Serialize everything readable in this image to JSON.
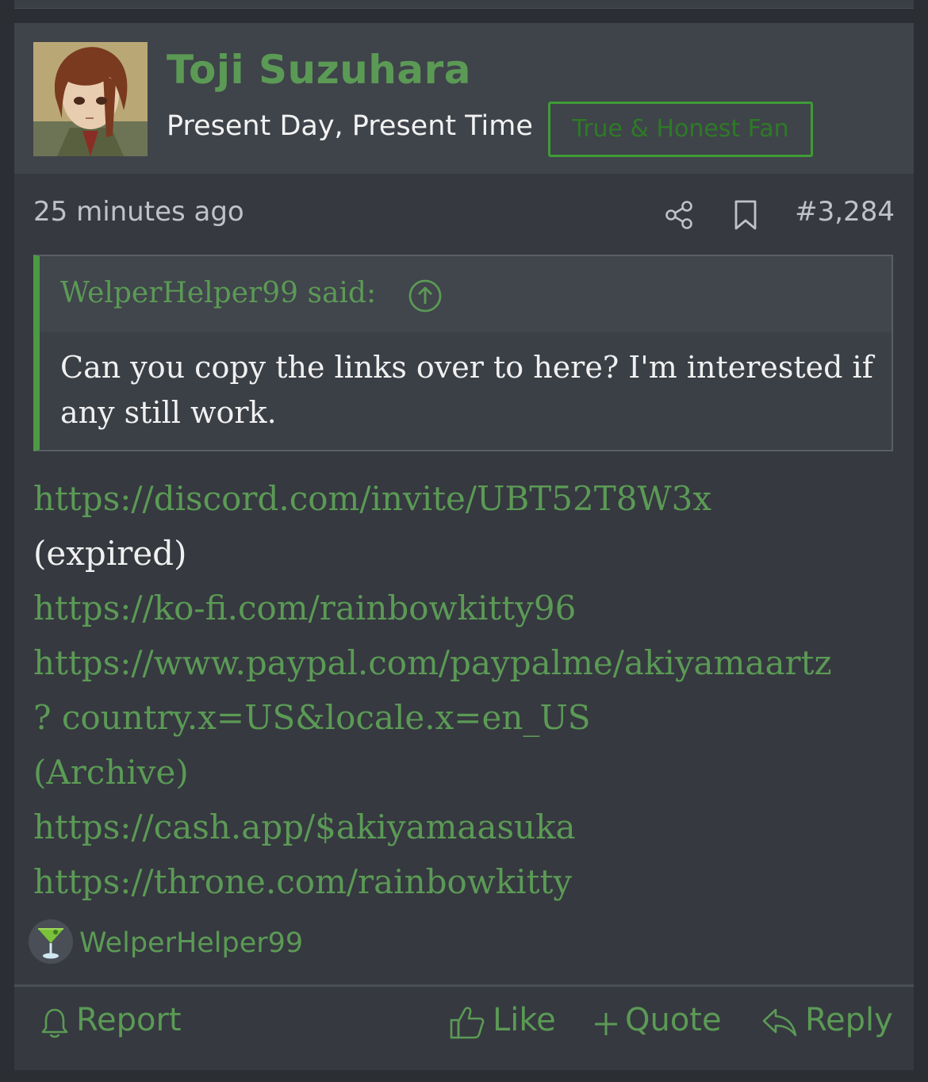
{
  "post": {
    "author": "Toji Suzuhara",
    "user_title": "Present Day, Present Time",
    "user_badge": "True & Honest Fan",
    "timestamp": "25 minutes ago",
    "post_number": "#3,284",
    "quote": {
      "author": "WelperHelper99 said:",
      "text": "Can you copy the links over to here? I'm interested if any still work."
    },
    "links": [
      {
        "text": "https://discord.com/invite/UBT52T8W3x",
        "type": "link"
      },
      {
        "text": "(expired)",
        "type": "plain"
      },
      {
        "text": "https://ko-fi.com/rainbowkitty96",
        "type": "link"
      },
      {
        "text": "https://www.paypal.com/paypalme/akiyamaartz",
        "type": "link"
      },
      {
        "text": "? country.x=US&locale.x=en_US",
        "type": "link"
      },
      {
        "text": "(Archive)",
        "type": "link"
      },
      {
        "text": "https://cash.app/$akiyamaasuka",
        "type": "link"
      },
      {
        "text": "https://throne.com/rainbowkitty",
        "type": "link"
      }
    ],
    "reaction": {
      "icon": "cocktail-glass-icon",
      "user": "WelperHelper99"
    }
  },
  "actions": {
    "report": "Report",
    "like": "Like",
    "quote": "Quote",
    "reply": "Reply"
  },
  "colors": {
    "accent": "#5b9a55",
    "background": "#363940",
    "header": "#3f434a",
    "badge_border": "#3f9b35"
  }
}
